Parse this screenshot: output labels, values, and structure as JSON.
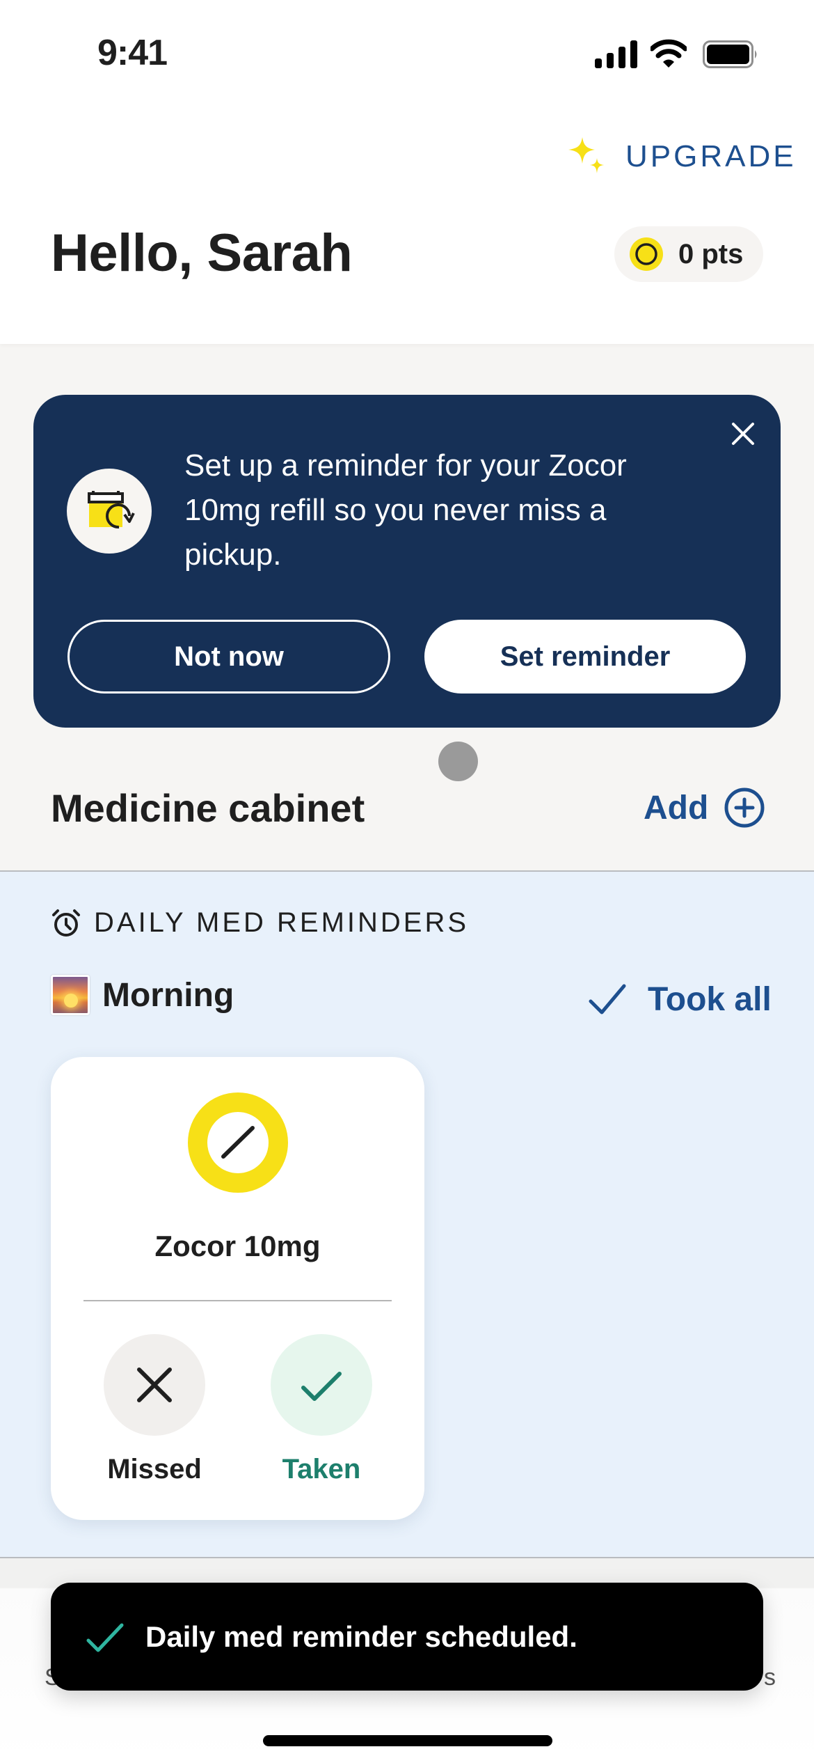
{
  "status_bar": {
    "time": "9:41",
    "icons": [
      "cellular-signal-icon",
      "wifi-icon",
      "battery-icon"
    ]
  },
  "header": {
    "upgrade_label": "UPGRADE",
    "upgrade_icon": "sparkle-icon",
    "greeting": "Hello, Sarah",
    "points_label": "0 pts",
    "points_icon": "coin-icon"
  },
  "banner": {
    "icon": "calendar-refill-icon",
    "message": "Set up a reminder for your Zocor 10mg refill so you never miss a pickup.",
    "dismiss_label": "Not now",
    "confirm_label": "Set reminder",
    "close_icon": "close-icon"
  },
  "medicine_cabinet": {
    "title": "Medicine cabinet",
    "add_label": "Add",
    "add_icon": "plus-circle-icon"
  },
  "daily_reminders": {
    "section_label": "DAILY MED REMINDERS",
    "section_icon": "alarm-clock-icon",
    "groups": [
      {
        "time_of_day": "Morning",
        "icon": "sunrise-icon",
        "took_all_label": "Took all",
        "meds": [
          {
            "name": "Zocor 10mg",
            "missed_label": "Missed",
            "taken_label": "Taken"
          }
        ]
      }
    ]
  },
  "tab_bar": {
    "left_partial_label": "S",
    "right_partial_label": "s"
  },
  "toast": {
    "message": "Daily med reminder scheduled.",
    "icon": "check-icon"
  },
  "colors": {
    "brand_navy": "#163056",
    "link_blue": "#1d4f8f",
    "accent_yellow": "#f7e017",
    "success_green": "#1d7f6c",
    "reminders_bg": "#e8f1fb"
  }
}
